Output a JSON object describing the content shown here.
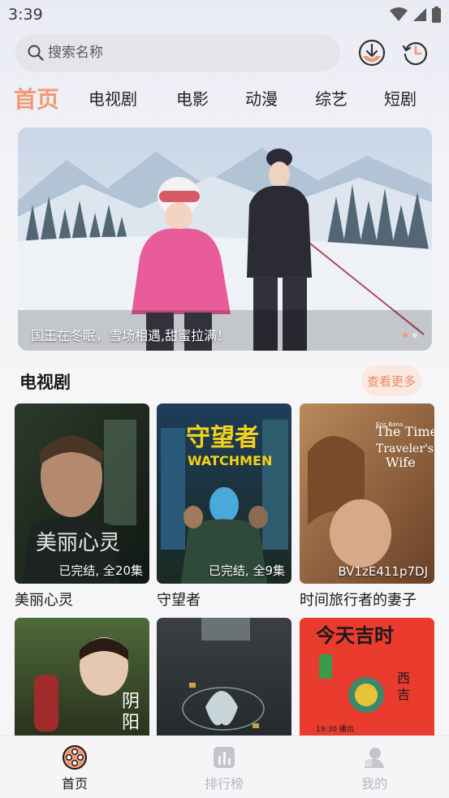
{
  "status_bar": {
    "time": "3:39"
  },
  "search": {
    "placeholder": "搜索名称"
  },
  "tabs": [
    "首页",
    "电视剧",
    "电影",
    "动漫",
    "综艺",
    "短剧"
  ],
  "banner": {
    "caption": "国王在冬眠，雪场相遇,甜蜜拉满！"
  },
  "section": {
    "title": "电视剧",
    "more_label": "查看更多"
  },
  "cards": [
    {
      "title": "美丽心灵",
      "badge": "已完结, 全20集",
      "poster_text": "美丽心灵"
    },
    {
      "title": "守望者",
      "badge": "已完结, 全9集",
      "poster_text": "守望者",
      "poster_subtext": "WATCHMEN"
    },
    {
      "title": "时间旅行者的妻子",
      "badge": "BV1zE411p7DJ",
      "poster_text": "The Time Traveler's Wife",
      "poster_subtext": "Eric Bana  Rachel McAdams"
    },
    {
      "title": "",
      "badge": "",
      "poster_text": "阴阳"
    },
    {
      "title": "",
      "badge": "",
      "poster_text": ""
    },
    {
      "title": "",
      "badge": "",
      "poster_text": "今天吉时"
    }
  ],
  "bottom_nav": [
    {
      "label": "首页",
      "icon": "film-reel-icon",
      "active": true
    },
    {
      "label": "排行榜",
      "icon": "ranking-chart-icon",
      "active": false
    },
    {
      "label": "我的",
      "icon": "profile-icon",
      "active": false
    }
  ],
  "colors": {
    "accent": "#f19a78",
    "more_bg": "#fbe9e1",
    "inactive_nav": "#b8b8bd"
  }
}
